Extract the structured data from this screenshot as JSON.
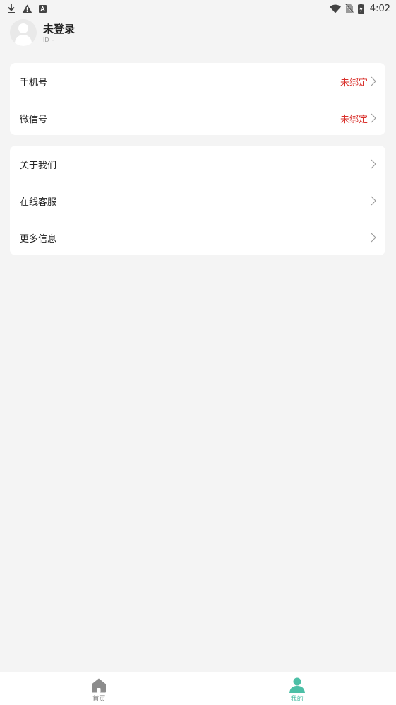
{
  "status_bar": {
    "time": "4:02",
    "left_icons": [
      "download-icon",
      "warning-icon",
      "a-box-icon"
    ],
    "right_icons": [
      "wifi-icon",
      "no-sim-icon",
      "battery-charging-icon"
    ]
  },
  "profile": {
    "name": "未登录",
    "id_label": "ID",
    "id_value": "-"
  },
  "account_card": {
    "items": [
      {
        "label": "手机号",
        "value": "未绑定"
      },
      {
        "label": "微信号",
        "value": "未绑定"
      }
    ]
  },
  "info_card": {
    "items": [
      {
        "label": "关于我们"
      },
      {
        "label": "在线客服"
      },
      {
        "label": "更多信息"
      }
    ]
  },
  "bottom_nav": {
    "items": [
      {
        "label": "首页",
        "icon": "home-icon",
        "active": false
      },
      {
        "label": "我的",
        "icon": "person-icon",
        "active": true
      }
    ]
  },
  "colors": {
    "accent": "#4cbfa6",
    "warning_text": "#d9302b",
    "background": "#f4f4f4"
  }
}
